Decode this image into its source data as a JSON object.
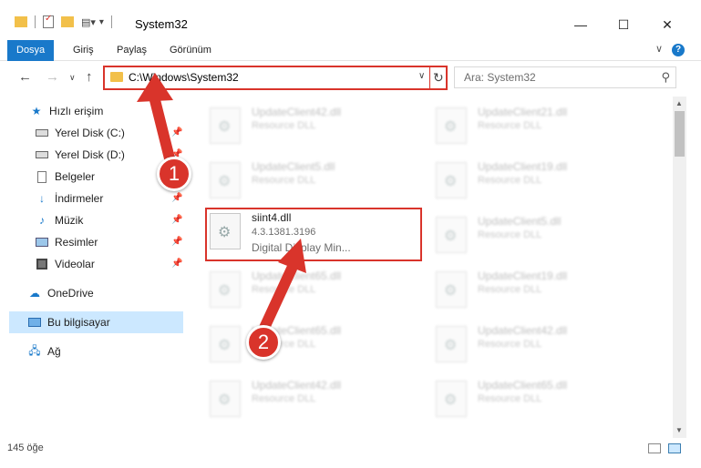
{
  "window": {
    "title": "System32",
    "minimize": "—",
    "maximize": "☐",
    "close": "✕"
  },
  "ribbon": {
    "tabs": [
      "Dosya",
      "Giriş",
      "Paylaş",
      "Görünüm"
    ],
    "help": "?"
  },
  "nav": {
    "address": "C:\\Windows\\System32",
    "search_placeholder": "Ara: System32"
  },
  "sidebar": {
    "items": [
      {
        "label": "Hızlı erişim",
        "icon": "star-icon"
      },
      {
        "label": "Yerel Disk (C:)",
        "icon": "drive-icon",
        "pinned": true
      },
      {
        "label": "Yerel Disk (D:)",
        "icon": "drive-icon",
        "pinned": true
      },
      {
        "label": "Belgeler",
        "icon": "document-icon",
        "pinned": true
      },
      {
        "label": "İndirmeler",
        "icon": "download-icon",
        "pinned": true
      },
      {
        "label": "Müzik",
        "icon": "music-icon",
        "pinned": true
      },
      {
        "label": "Resimler",
        "icon": "pictures-icon",
        "pinned": true
      },
      {
        "label": "Videolar",
        "icon": "video-icon",
        "pinned": true
      },
      {
        "label": "OneDrive",
        "icon": "cloud-icon"
      },
      {
        "label": "Bu bilgisayar",
        "icon": "computer-icon",
        "selected": true
      },
      {
        "label": "Ağ",
        "icon": "network-icon"
      }
    ]
  },
  "files": {
    "col1": [
      {
        "name": "UpdateClient42.dll",
        "desc": "Resource DLL"
      },
      {
        "name": "UpdateClient5.dll",
        "desc": "Resource DLL"
      },
      {
        "name": "siint4.dll",
        "version": "4.3.1381.3196",
        "desc": "Digital Display Min..."
      },
      {
        "name": "UpdateClient65.dll",
        "desc": "Resource DLL"
      },
      {
        "name": "UpdateClient65.dll",
        "desc": "Resource DLL"
      },
      {
        "name": "UpdateClient42.dll",
        "desc": "Resource DLL"
      }
    ],
    "col2": [
      {
        "name": "UpdateClient21.dll",
        "desc": "Resource DLL"
      },
      {
        "name": "UpdateClient19.dll",
        "desc": "Resource DLL"
      },
      {
        "name": "UpdateClient5.dll",
        "desc": "Resource DLL"
      },
      {
        "name": "UpdateClient19.dll",
        "desc": "Resource DLL"
      },
      {
        "name": "UpdateClient42.dll",
        "desc": "Resource DLL"
      },
      {
        "name": "UpdateClient65.dll",
        "desc": "Resource DLL"
      }
    ]
  },
  "status": {
    "count": "145 öğe"
  },
  "annotations": {
    "badge1": "1",
    "badge2": "2"
  },
  "colors": {
    "accent": "#1979ca",
    "highlight": "#d9342b",
    "selected": "#cce8ff"
  }
}
